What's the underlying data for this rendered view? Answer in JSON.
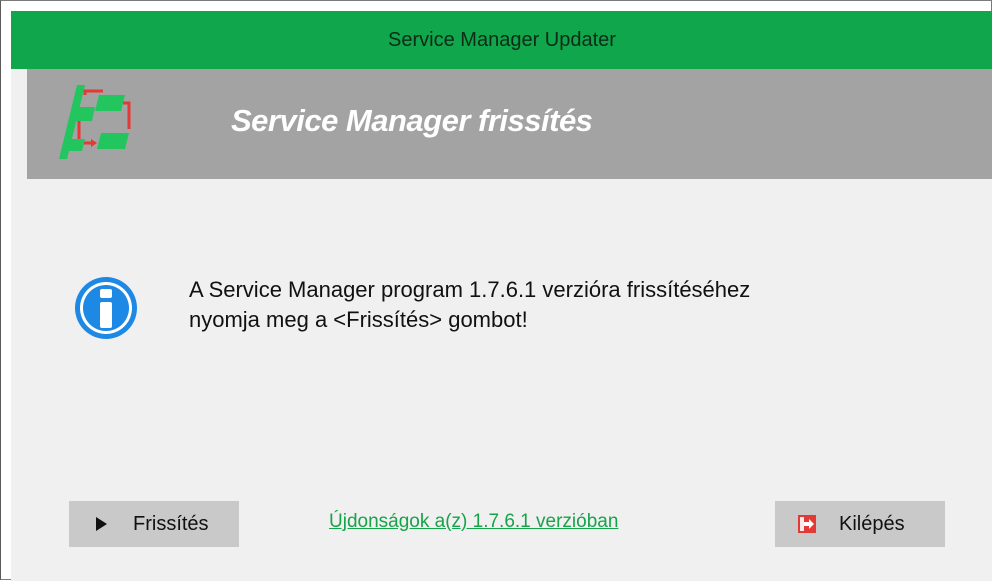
{
  "window": {
    "title": "Service Manager Updater"
  },
  "banner": {
    "title": "Service Manager frissítés",
    "logo_icon": "workflow-diagram-icon"
  },
  "message": {
    "icon": "info-icon",
    "line1": "A Service Manager program 1.7.6.1 verzióra frissítéséhez",
    "line2": "nyomja meg a <Frissítés> gombot!"
  },
  "buttons": {
    "update_label": "Frissítés",
    "update_icon": "play-arrow-icon",
    "exit_label": "Kilépés",
    "exit_icon": "exit-door-icon"
  },
  "link": {
    "text": "Újdonságok a(z) 1.7.6.1 verzióban"
  },
  "colors": {
    "titlebar": "#0fa64c",
    "banner": "#a3a3a3",
    "link": "#16a34a",
    "button": "#c9c9c9",
    "accent_red": "#e53935",
    "info_blue": "#1e88e5"
  }
}
